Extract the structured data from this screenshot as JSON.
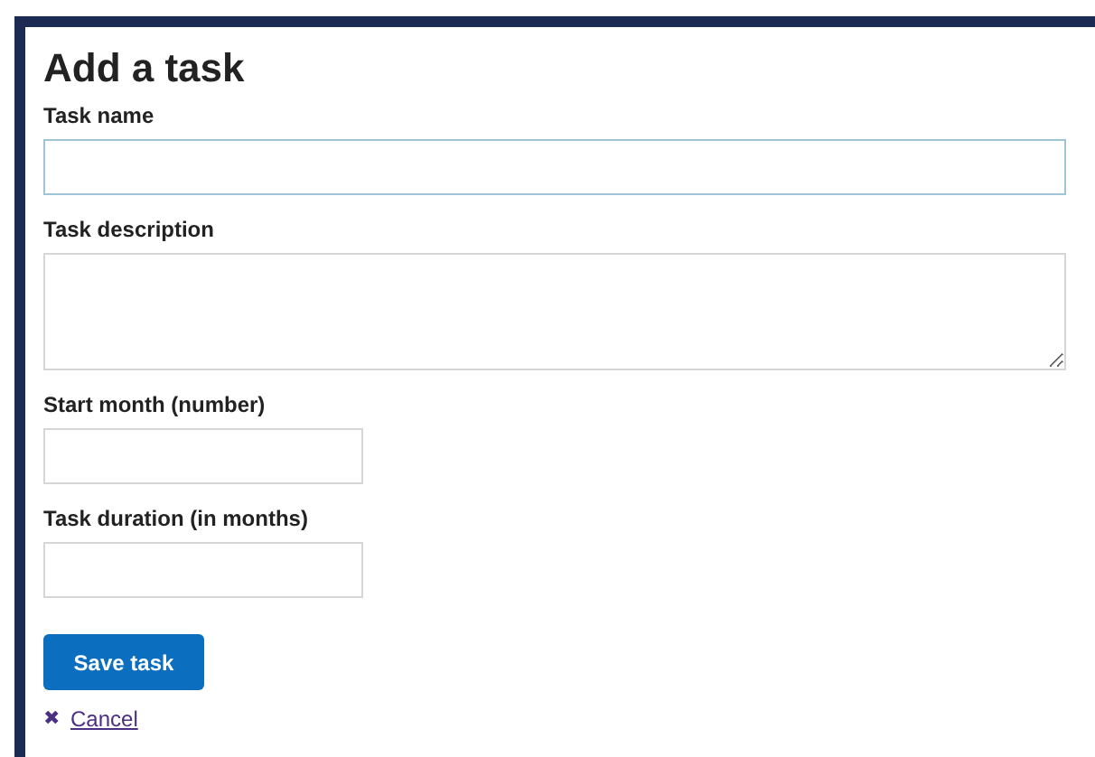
{
  "title": "Add a task",
  "fields": [
    {
      "label": "Task name",
      "kind": "wide",
      "focused": true
    },
    {
      "label": "Task description",
      "kind": "textarea",
      "focused": false
    },
    {
      "label": "Start month (number)",
      "kind": "short",
      "focused": false
    },
    {
      "label": "Task duration (in months)",
      "kind": "short",
      "focused": false
    }
  ],
  "save_button": "Save task",
  "cancel": {
    "icon": "✖",
    "label": "Cancel"
  }
}
